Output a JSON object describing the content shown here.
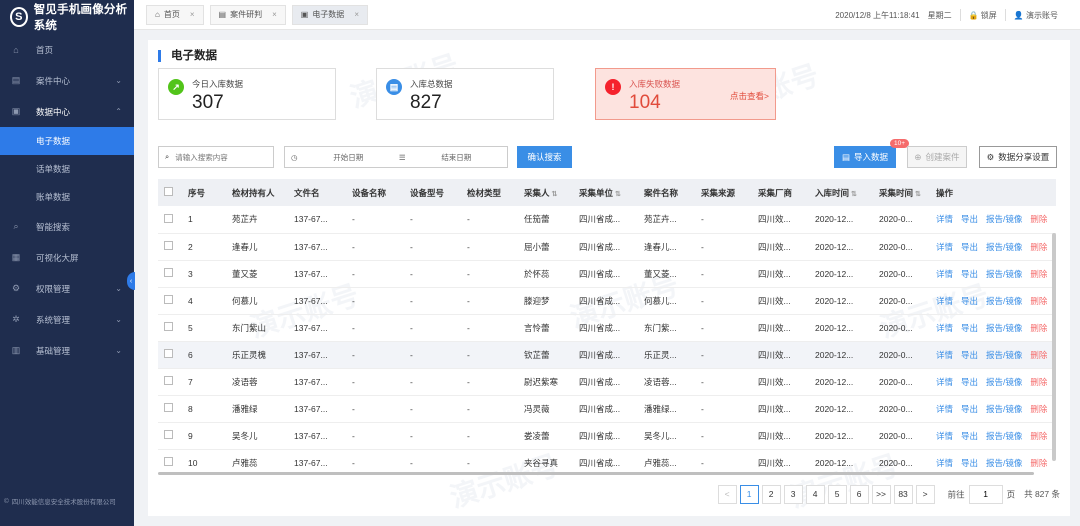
{
  "app": {
    "title": "智见手机画像分析系统",
    "logo_glyph": "S",
    "company": "四川效能信息安全技术股份有限公司"
  },
  "sidebar": {
    "items": [
      {
        "label": "首页",
        "icon": "home-icon",
        "glyph": "⌂"
      },
      {
        "label": "案件中心",
        "icon": "case-icon",
        "glyph": "▤",
        "chevron": "⌄"
      },
      {
        "label": "数据中心",
        "icon": "data-icon",
        "glyph": "▣",
        "chevron": "⌃"
      },
      {
        "label": "智能搜索",
        "icon": "search-icon",
        "glyph": "⌕"
      },
      {
        "label": "可视化大屏",
        "icon": "screen-icon",
        "glyph": "▦"
      },
      {
        "label": "权限管理",
        "icon": "permission-icon",
        "glyph": "⚙",
        "chevron": "⌄"
      },
      {
        "label": "系统管理",
        "icon": "system-icon",
        "glyph": "✲",
        "chevron": "⌄"
      },
      {
        "label": "基础管理",
        "icon": "base-icon",
        "glyph": "▥",
        "chevron": "⌄"
      }
    ],
    "sub_items": [
      "电子数据",
      "话单数据",
      "账单数据"
    ]
  },
  "topbar": {
    "tabs": [
      {
        "label": "首页",
        "glyph": "⌂"
      },
      {
        "label": "案件研判",
        "glyph": "▤"
      },
      {
        "label": "电子数据",
        "glyph": "▣"
      }
    ],
    "close_glyph": "×",
    "datetime": "2020/12/8 上午11:18:41",
    "weekday": "星期二",
    "lock_label": "锁屏",
    "user": "演示账号"
  },
  "page": {
    "title": "电子数据",
    "stats": [
      {
        "label": "今日入库数据",
        "value": "307",
        "color": "#52c41a",
        "glyph": "↗"
      },
      {
        "label": "入库总数据",
        "value": "827",
        "color": "#3a8ee6",
        "glyph": "▤"
      },
      {
        "label": "入库失败数据",
        "value": "104",
        "color": "#f5222d",
        "glyph": "!",
        "link": "点击查看>"
      }
    ]
  },
  "toolbar": {
    "search_placeholder": "请输入搜索内容",
    "start_date": "开始日期",
    "end_date": "结束日期",
    "confirm_search": "确认搜索",
    "import": "导入数据",
    "import_badge": "10+",
    "create_case": "创建案件",
    "share_settings": "数据分享设置"
  },
  "table": {
    "columns": [
      "序号",
      "检材持有人",
      "文件名",
      "设备名称",
      "设备型号",
      "检材类型",
      "采集人",
      "采集单位",
      "案件名称",
      "采集来源",
      "采集厂商",
      "入库时间",
      "采集时间",
      "操作"
    ],
    "sortable": [
      "采集人",
      "采集单位",
      "入库时间",
      "采集时间"
    ],
    "sort_glyph": "⇅",
    "ops": [
      "详情",
      "导出",
      "报告/镜像",
      "删除"
    ],
    "rows": [
      [
        "1",
        "苑芷卉",
        "137-67...",
        "-",
        "-",
        "-",
        "任笳蕾",
        "四川省成...",
        "苑芷卉...",
        "-",
        "四川效...",
        "2020-12...",
        "2020-0..."
      ],
      [
        "2",
        "逢春儿",
        "137-67...",
        "-",
        "-",
        "-",
        "屈小蕾",
        "四川省成...",
        "逢春儿...",
        "-",
        "四川效...",
        "2020-12...",
        "2020-0..."
      ],
      [
        "3",
        "董又菱",
        "137-67...",
        "-",
        "-",
        "-",
        "於怀蕊",
        "四川省成...",
        "董又菱...",
        "-",
        "四川效...",
        "2020-12...",
        "2020-0..."
      ],
      [
        "4",
        "何慕儿",
        "137-67...",
        "-",
        "-",
        "-",
        "滕迎梦",
        "四川省成...",
        "何慕儿...",
        "-",
        "四川效...",
        "2020-12...",
        "2020-0..."
      ],
      [
        "5",
        "东门紫山",
        "137-67...",
        "-",
        "-",
        "-",
        "言怜蕾",
        "四川省成...",
        "东门紫...",
        "-",
        "四川效...",
        "2020-12...",
        "2020-0..."
      ],
      [
        "6",
        "乐正灵槐",
        "137-67...",
        "-",
        "-",
        "-",
        "钦芷蕾",
        "四川省成...",
        "乐正灵...",
        "-",
        "四川效...",
        "2020-12...",
        "2020-0..."
      ],
      [
        "7",
        "凌语蓉",
        "137-67...",
        "-",
        "-",
        "-",
        "尉迟紫寒",
        "四川省成...",
        "凌语蓉...",
        "-",
        "四川效...",
        "2020-12...",
        "2020-0..."
      ],
      [
        "8",
        "潘雅绿",
        "137-67...",
        "-",
        "-",
        "-",
        "冯灵薇",
        "四川省成...",
        "潘雅绿...",
        "-",
        "四川效...",
        "2020-12...",
        "2020-0..."
      ],
      [
        "9",
        "吴冬儿",
        "137-67...",
        "-",
        "-",
        "-",
        "娄凌蕾",
        "四川省成...",
        "吴冬儿...",
        "-",
        "四川效...",
        "2020-12...",
        "2020-0..."
      ],
      [
        "10",
        "卢雅蕊",
        "137-67...",
        "-",
        "-",
        "-",
        "夹谷寻真",
        "四川省成...",
        "卢雅蕊...",
        "-",
        "四川效...",
        "2020-12...",
        "2020-0..."
      ]
    ],
    "highlight_row": 6
  },
  "pagination": {
    "prev": "<",
    "pages": [
      "1",
      "2",
      "3",
      "4",
      "5",
      "6",
      ">>",
      "83"
    ],
    "next": ">",
    "current": "1",
    "goto_label": "前往",
    "goto_value": "1",
    "page_unit": "页",
    "total": "共 827 条"
  },
  "watermark": "演示账号"
}
